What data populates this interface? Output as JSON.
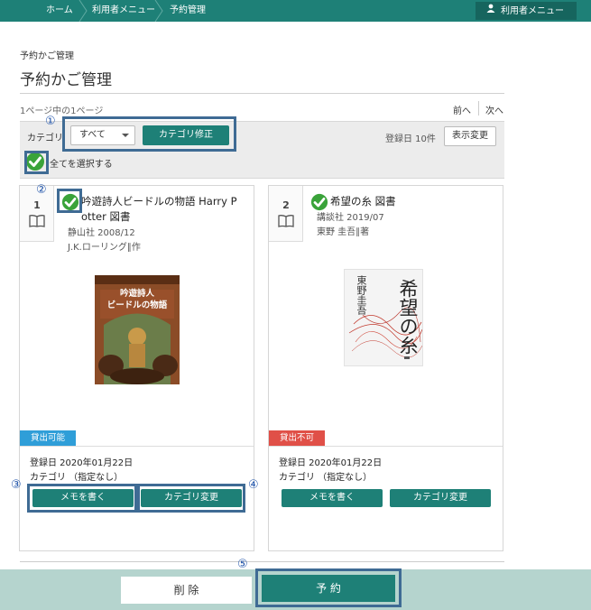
{
  "breadcrumb": {
    "home": "ホーム",
    "user_menu": "利用者メニュー",
    "current": "予約管理"
  },
  "header": {
    "user_menu_label": "利用者メニュー"
  },
  "page": {
    "subtitle": "予約かご管理",
    "title": "予約かご管理"
  },
  "pagination": {
    "info": "1ページ中の1ページ",
    "prev": "前へ",
    "next": "次へ"
  },
  "controls": {
    "category_label": "カテゴリ",
    "category_value": "すべて",
    "category_fix_label": "カテゴリ修正",
    "registered_count": "登録日 10件",
    "display_change_label": "表示変更",
    "select_all_label": "全てを選択する"
  },
  "callouts": [
    "①",
    "②",
    "③",
    "④",
    "⑤"
  ],
  "cards": [
    {
      "number": "1",
      "title_line1": "吟遊詩人ビードルの物語 Harry P",
      "title_line2": "otter 図書",
      "publisher": "静山社 2008/12",
      "author": "J.K.ローリング∥作",
      "cover_text1": "吟遊詩人",
      "cover_text2": "ビードルの物語",
      "status": "貸出可能",
      "registered": "登録日 2020年01月22日",
      "category": "カテゴリ （指定なし）",
      "memo_label": "メモを書く",
      "category_change_label": "カテゴリ変更"
    },
    {
      "number": "2",
      "title_line1": "希望の糸 図書",
      "publisher": "講談社 2019/07",
      "author": "東野 圭吾∥著",
      "cover_author": "東野圭吾",
      "cover_title": "希望の糸",
      "status": "貸出不可",
      "registered": "登録日 2020年01月22日",
      "category": "カテゴリ （指定なし）",
      "memo_label": "メモを書く",
      "category_change_label": "カテゴリ変更"
    }
  ],
  "footer": {
    "delete_label": "削 除",
    "reserve_label": "予 約"
  },
  "colors": {
    "primary": "#1e8077",
    "available": "#2f9ed8",
    "unavailable": "#e05048",
    "callout": "#3f6b94",
    "footer": "#b5d4ce"
  }
}
